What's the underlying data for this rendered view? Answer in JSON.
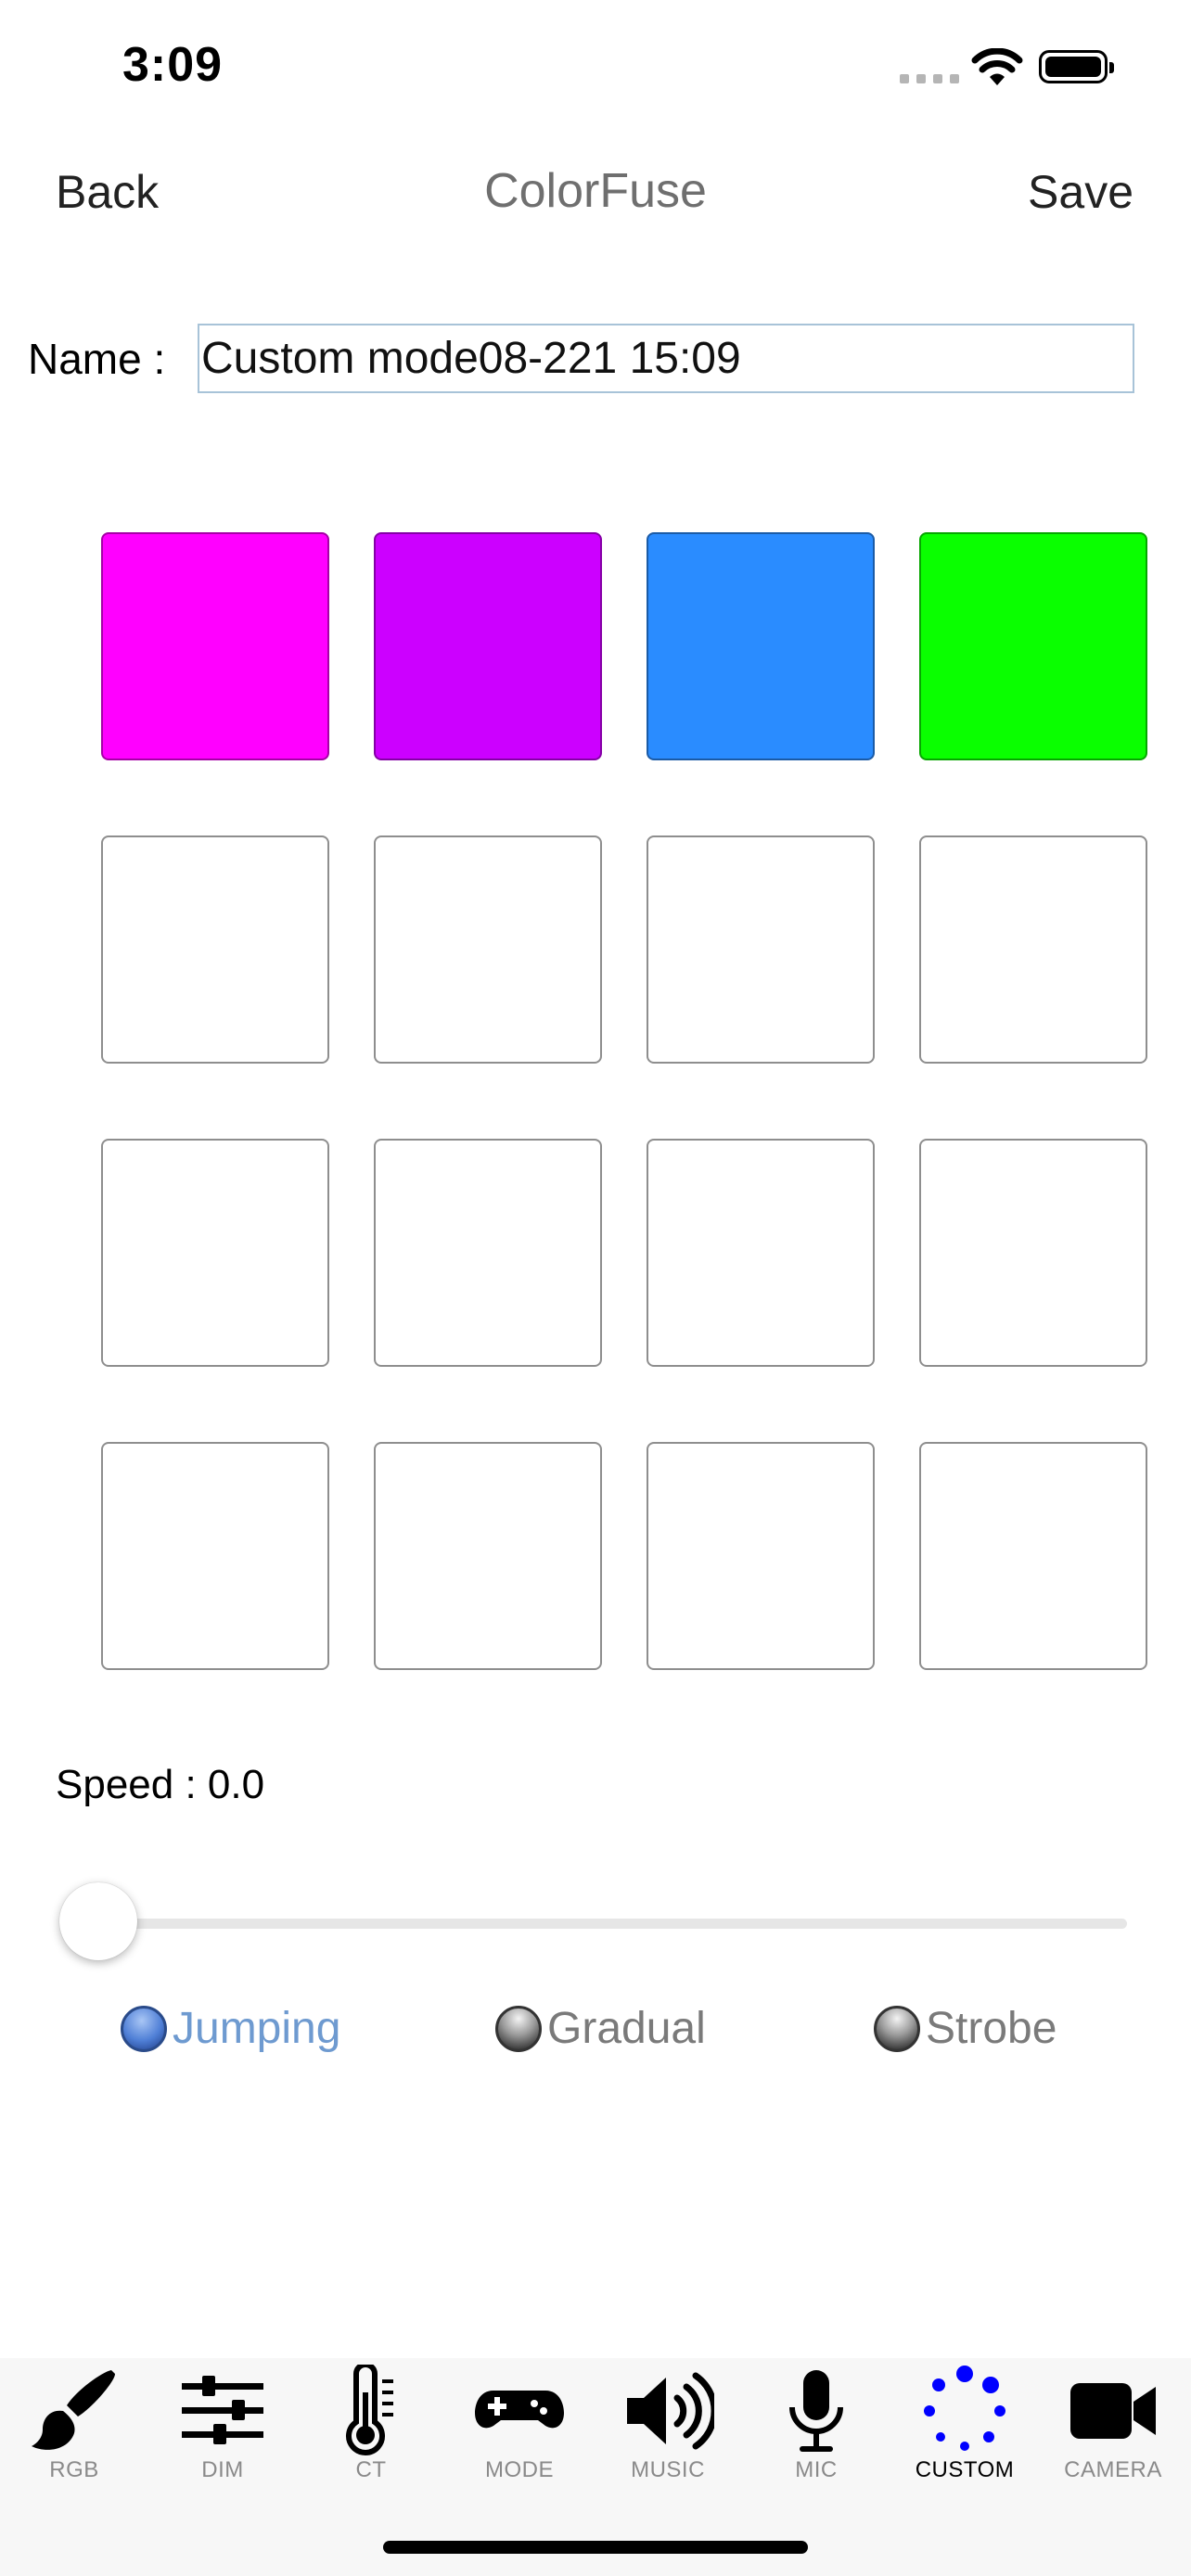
{
  "status_bar": {
    "time": "3:09"
  },
  "nav": {
    "back": "Back",
    "title": "ColorFuse",
    "save": "Save"
  },
  "name": {
    "label": "Name :",
    "value": "Custom mode08-221 15:09"
  },
  "swatches": [
    "#ff00ff",
    "#cc00ff",
    "#2a8cff",
    "#0aff00",
    "",
    "",
    "",
    "",
    "",
    "",
    "",
    "",
    "",
    "",
    "",
    ""
  ],
  "speed": {
    "label": "Speed : 0.0",
    "value": 0.0
  },
  "modes": {
    "jumping": "Jumping",
    "gradual": "Gradual",
    "strobe": "Strobe",
    "selected": "Jumping"
  },
  "tabs": {
    "rgb": "RGB",
    "dim": "DIM",
    "ct": "CT",
    "mode": "MODE",
    "music": "MUSIC",
    "mic": "MIC",
    "custom": "CUSTOM",
    "camera": "CAMERA",
    "selected": "CUSTOM"
  },
  "colors": {
    "accent_blue": "#0000ff",
    "radio_active": "#6e9ad0"
  }
}
